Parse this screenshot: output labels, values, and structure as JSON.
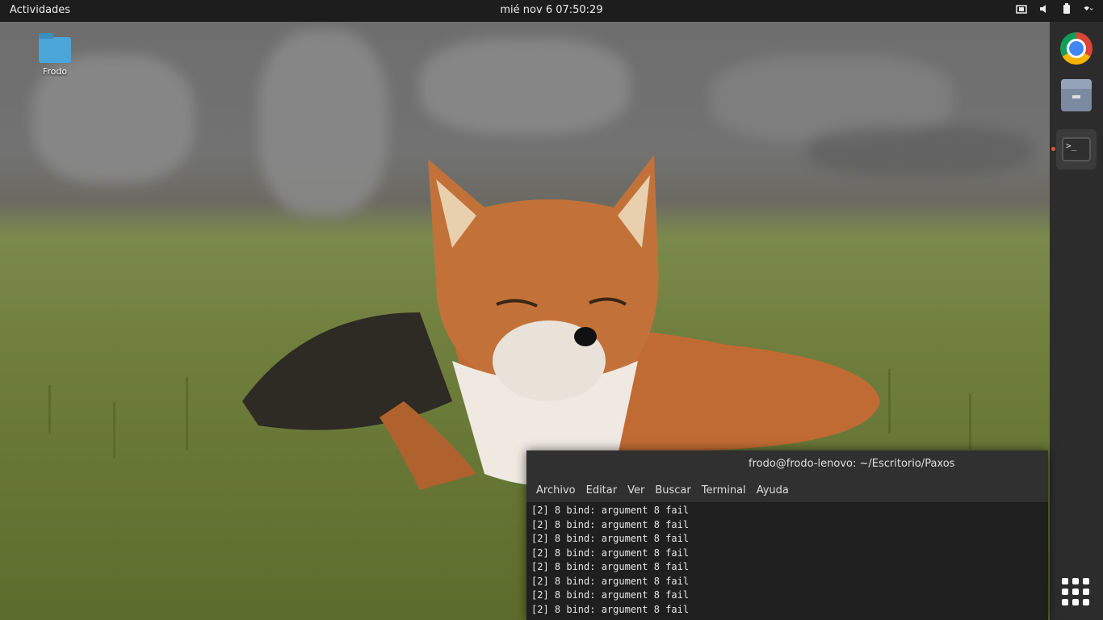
{
  "topbar": {
    "activities": "Actividades",
    "clock": "mié nov  6  07:50:29",
    "tray_icons": [
      "network-icon",
      "volume-icon",
      "battery-icon",
      "system-menu-icon"
    ]
  },
  "desktop": {
    "icons": [
      {
        "label": "Frodo",
        "icon": "folder-icon"
      }
    ]
  },
  "dock": {
    "items": [
      {
        "name": "chrome-icon"
      },
      {
        "name": "files-icon"
      },
      {
        "name": "terminal-icon",
        "label": ">_"
      }
    ],
    "show_apps": "apps-grid-icon"
  },
  "terminal": {
    "title": "frodo@frodo-lenovo: ~/Escritorio/Paxos",
    "menu": [
      "Archivo",
      "Editar",
      "Ver",
      "Buscar",
      "Terminal",
      "Ayuda"
    ],
    "lines": [
      "[2] 8 bind: argument 8 fail",
      "[2] 8 bind: argument 8 fail",
      "[2] 8 bind: argument 8 fail",
      "[2] 8 bind: argument 8 fail",
      "[2] 8 bind: argument 8 fail",
      "[2] 8 bind: argument 8 fail",
      "[2] 8 bind: argument 8 fail",
      "[2] 8 bind: argument 8 fail"
    ]
  },
  "colors": {
    "topbar_bg": "#1d1d1d",
    "dock_bg": "#2c2c2c",
    "terminal_bg": "#1f1f1f",
    "accent": "#e95420"
  }
}
